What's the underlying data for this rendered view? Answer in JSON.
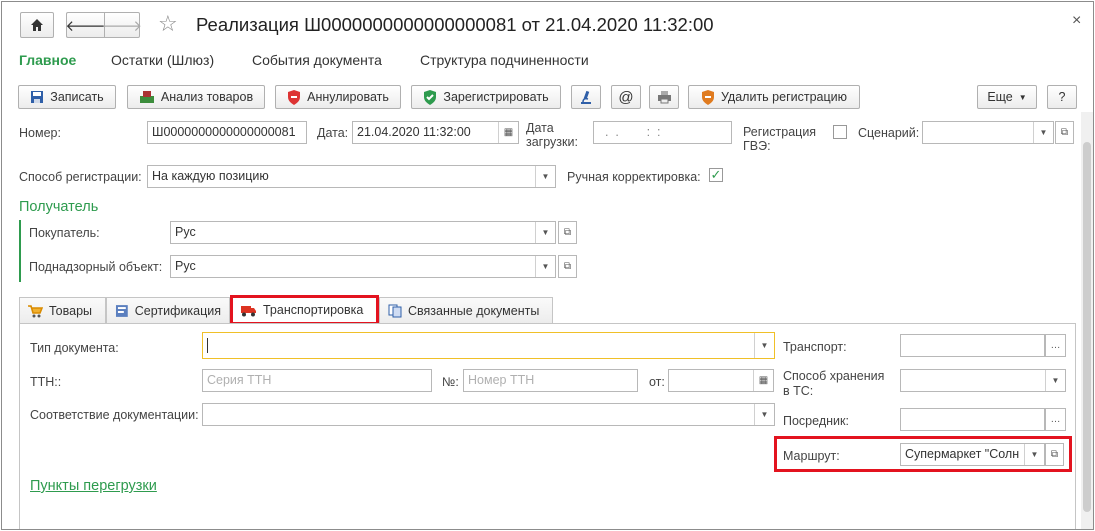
{
  "window": {
    "title": "Реализация Ш0000000000000000081 от 21.04.2020 11:32:00",
    "close_glyph": "×"
  },
  "menu": {
    "main": "Главное",
    "remains": "Остатки (Шлюз)",
    "events": "События документа",
    "structure": "Структура подчиненности"
  },
  "toolbar": {
    "save": "Записать",
    "analyze": "Анализ товаров",
    "cancel": "Аннулировать",
    "register": "Зарегистрировать",
    "at": "@",
    "delete_reg": "Удалить регистрацию",
    "more": "Еще",
    "help": "?"
  },
  "header": {
    "number_label": "Номер:",
    "number_value": "Ш0000000000000000081",
    "date_label": "Дата:",
    "date_value": "21.04.2020 11:32:00",
    "load_date_label_1": "Дата",
    "load_date_label_2": "загрузки:",
    "load_date_value": "  .  .        :  :",
    "gve_label_1": "Регистрация",
    "gve_label_2": "ГВЭ:",
    "scenario_label": "Сценарий:",
    "reg_method_label": "Способ регистрации:",
    "reg_method_value": "На каждую позицию",
    "manual_label": "Ручная корректировка:",
    "manual_check": "✓"
  },
  "recipient": {
    "section": "Получатель",
    "buyer_label": "Покупатель:",
    "buyer_value": "Рус",
    "object_label": "Поднадзорный объект:",
    "object_value": "Рус"
  },
  "tabs": {
    "goods": "Товары",
    "cert": "Сертификация",
    "transport": "Транспортировка",
    "related": "Связанные документы"
  },
  "transport": {
    "doc_type_label": "Тип документа:",
    "ttn_label": "ТТН::",
    "ttn_series_ph": "Серия ТТН",
    "num_label": "№:",
    "num_ph": "Номер ТТН",
    "from_label": "от:",
    "from_value": " .  .",
    "conform_label": "Соответствие документации:",
    "vehicle_label": "Транспорт:",
    "storage_label_1": "Способ хранения",
    "storage_label_2": "в ТС:",
    "broker_label": "Посредник:",
    "route_label": "Маршрут:",
    "route_value": "Супермаркет \"Солн",
    "reload_link": "Пункты перегрузки"
  },
  "colors": {
    "accent_green": "#2e9b4e",
    "highlight_red": "#e3131f",
    "focus_yellow": "#f0c028"
  }
}
